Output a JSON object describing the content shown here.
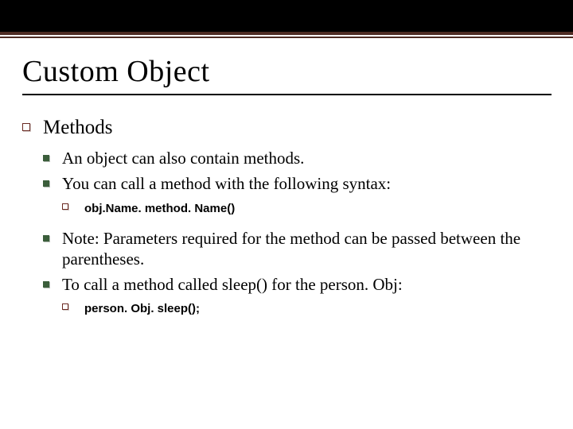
{
  "title": "Custom Object",
  "heading": "Methods",
  "bullets": {
    "b1": "An object can also contain methods.",
    "b2": "You can call a method with the following syntax:",
    "b2_code": "obj.Name. method. Name()",
    "b3": "Note: Parameters required for the method can be passed between the parentheses.",
    "b4": "To call a method called sleep() for the person. Obj:",
    "b4_code": "person. Obj. sleep();"
  }
}
